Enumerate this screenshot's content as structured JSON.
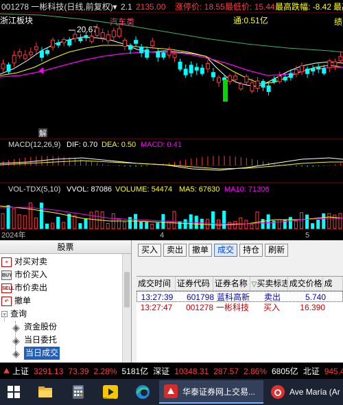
{
  "chart": {
    "header": {
      "code_title": "001278 一彬科技(日线,前复权)",
      "arrow": "▼",
      "version": "2.1",
      "price": "2135.00",
      "limit_up_label": "涨停价: 18.55",
      "lowest_label": "最低价: 15.44",
      "max_drop_label": "最高跌幅: -8.42",
      "max_label": "最高"
    },
    "sector_label": "浙江板块",
    "auto_label": "汽车类",
    "tong_label": "通:0.51亿",
    "tag_right": "绩",
    "high_marker": "20.67",
    "jie_label": "解",
    "macd_line": {
      "title": "MACD(12,26,9)",
      "dif": "DIF: 0.70",
      "dea": "DEA: 0.50",
      "macd": "MACD: 0.41"
    },
    "vol_line": {
      "title": "VOL-TDX(5,10)",
      "vvol": "VVOL: 87086",
      "volume": "VOLUME: 54474",
      "ma5": "MA5: 67630",
      "ma10": "MA10: 71306"
    },
    "x_axis": {
      "year": "2024年",
      "m4": "4",
      "m5": "5"
    }
  },
  "tree": {
    "header": "股票",
    "items": [
      {
        "label": "对买对卖",
        "icon": "red-doc-icon"
      },
      {
        "label": "市价买入",
        "icon": "buy-icon"
      },
      {
        "label": "市价卖出",
        "icon": "sell-icon"
      },
      {
        "label": "撤单",
        "icon": "withdraw-icon"
      },
      {
        "label": "查询",
        "icon": "query-folder"
      },
      {
        "label": "资金股份",
        "icon": "diamond-icon"
      },
      {
        "label": "当日委托",
        "icon": "diamond-icon"
      },
      {
        "label": "当日成交",
        "icon": "diamond-icon"
      }
    ],
    "ico_texts": {
      "buy": "BUY",
      "sell": "SELL",
      "minus": "−"
    }
  },
  "toolbar": {
    "buy": "买入",
    "sell": "卖出",
    "withdraw": "撤单",
    "deal": "成交",
    "position": "持仓",
    "refresh": "刷新"
  },
  "grid": {
    "headers": [
      "成交时间",
      "证券代码",
      "证券名称",
      "买卖标志",
      "成交价格",
      "成"
    ],
    "header_triangle": "▽",
    "rows": [
      {
        "time": "13:27:39",
        "code": "601798",
        "name": "蓝科高新",
        "flag": "卖出",
        "price": "5.740"
      },
      {
        "time": "13:27:47",
        "code": "001278",
        "name": "一彬科技",
        "flag": "买入",
        "price": "16.390"
      }
    ]
  },
  "status": {
    "sh_label": "上证",
    "sh_value": "3291.13",
    "sh_change": "73.39",
    "sh_pct": "2.28%",
    "sh_amount": "5181亿",
    "sz_label": "深证",
    "sz_value": "10348.31",
    "sz_change": "287.57",
    "sz_pct": "2.86%",
    "sz_amount": "6805亿",
    "bz_label": "北证",
    "bz_value": "945.4"
  },
  "taskbar": {
    "active_window": "华泰证券网上交易...",
    "music_window": "Ave María (Ar",
    "player_label": "Player",
    "icons": [
      "windows-start-icon",
      "file-explorer-icon",
      "calculator-icon",
      "player-icon",
      "edge-browser-icon",
      "huatai-app-icon",
      "netease-music-icon"
    ]
  },
  "colors": {
    "up_red": "#ff3b3b",
    "down_cyan": "#00ffff",
    "down_green": "#00d800",
    "macd_yellow": "#ffff00",
    "magenta": "#ff00ff"
  }
}
